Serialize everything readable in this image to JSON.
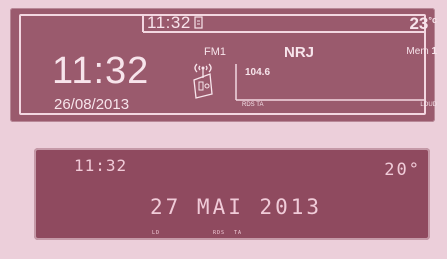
{
  "top_display": {
    "header_time": "11:32",
    "header_temp_value": "23",
    "header_temp_unit": "°c",
    "clock_time": "11:32",
    "clock_date": "26/08/2013",
    "band": "FM1",
    "station": "NRJ",
    "memory_label": "Mem",
    "memory_value": "1",
    "frequency": "104.6",
    "rds_ta": "RDS TA",
    "loud": "LOUD"
  },
  "bottom_display": {
    "time": "11:32",
    "temperature": "20°",
    "date": "27 MAI 2013",
    "ld": "LD",
    "rds": "RDS",
    "ta": "TA"
  }
}
